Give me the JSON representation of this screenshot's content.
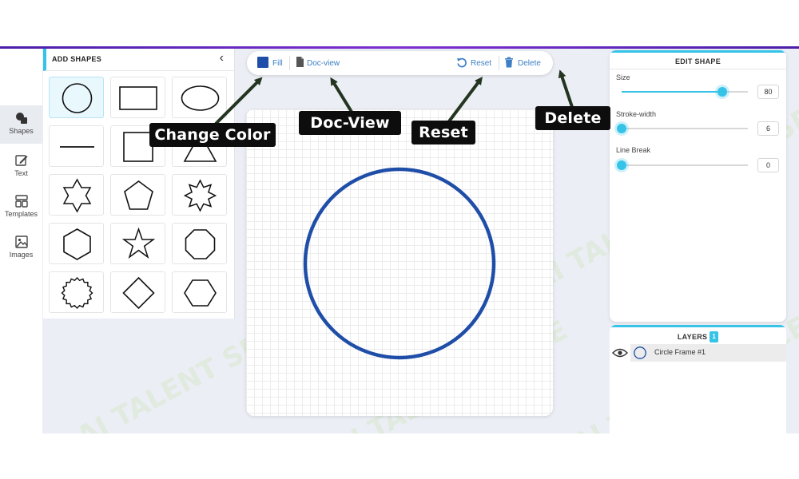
{
  "sidebar": {
    "items": [
      {
        "label": "Shapes",
        "icon": "shapes-icon",
        "active": true
      },
      {
        "label": "Text",
        "icon": "edit-pencil-icon",
        "active": false
      },
      {
        "label": "Templates",
        "icon": "templates-icon",
        "active": false
      },
      {
        "label": "Images",
        "icon": "image-icon",
        "active": false
      }
    ]
  },
  "shapes_panel": {
    "title": "ADD SHAPES",
    "back_icon": "chevron-left-icon",
    "shapes": [
      "circle",
      "rectangle",
      "ellipse",
      "line",
      "square",
      "triangle",
      "six-point-star",
      "pentagon",
      "eight-point-star",
      "hexagon",
      "five-point-star",
      "octagon",
      "badge",
      "diamond",
      "horizontal-hexagon"
    ],
    "selected": "circle"
  },
  "toolbar": {
    "fill_label": "Fill",
    "fill_color": "#1f4ea8",
    "docview_label": "Doc-view",
    "reset_label": "Reset",
    "delete_label": "Delete",
    "accent": "#3c7fc4"
  },
  "canvas": {
    "shape": "circle",
    "stroke_color": "#1f4ea8"
  },
  "edit_shape": {
    "title": "EDIT SHAPE",
    "controls": [
      {
        "label": "Size",
        "value": "80",
        "fraction": 0.8
      },
      {
        "label": "Stroke-width",
        "value": "6",
        "fraction": 0.0
      },
      {
        "label": "Line Break",
        "value": "0",
        "fraction": 0.0
      }
    ]
  },
  "layers": {
    "title": "LAYERS",
    "count": "1",
    "items": [
      {
        "name": "Circle Frame #1",
        "visible": true
      }
    ]
  },
  "annotations": {
    "change_color": "Change Color",
    "doc_view": "Doc-View",
    "reset": "Reset",
    "delete": "Delete"
  },
  "watermark": "AI TALENT SPACE",
  "colors": {
    "accent": "#36c3e8",
    "top_bar": "#6a2bc4",
    "workspace_bg": "#eceef5",
    "callout_bg": "#0d0d0d",
    "arrow_color": "#233520"
  }
}
